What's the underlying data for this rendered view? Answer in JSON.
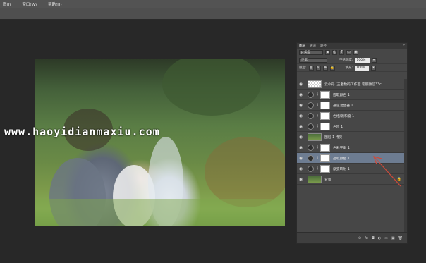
{
  "menu": [
    "图(I)",
    "窗口(W)",
    "帮助(H)"
  ],
  "watermark": "www.haoyidianmaxiu.com",
  "layers_panel": {
    "tabs": [
      "图层",
      "通道",
      "路径"
    ],
    "close": "»",
    "filter_label": "ρ 类型",
    "blend_mode": "正常",
    "opacity_label": "不透明度:",
    "opacity_value": "100%",
    "lock_label": "锁定:",
    "fill_label": "填充:",
    "fill_value": "100%",
    "layers": [
      {
        "name": "云小丹 (王者数码工作室  客服微信33c...",
        "thumb": "checker"
      },
      {
        "name": "选取颜色 1",
        "thumb": "mask"
      },
      {
        "name": "通道混合器 1",
        "thumb": "mask"
      },
      {
        "name": "色相/饱和度 1",
        "thumb": "mask"
      },
      {
        "name": "色阶 1",
        "thumb": "mask"
      },
      {
        "name": "图层 1 拷贝",
        "thumb": "photo"
      },
      {
        "name": "色彩平衡 1",
        "thumb": "mask"
      },
      {
        "name": "选取颜色 1",
        "thumb": "mask",
        "selected": true
      },
      {
        "name": "渐变映射 1",
        "thumb": "mask"
      },
      {
        "name": "背景",
        "thumb": "photo",
        "locked": true
      }
    ],
    "footer_icons": [
      "link-icon",
      "fx-icon",
      "mask-icon",
      "adjustment-icon",
      "folder-icon",
      "new-layer-icon",
      "trash-icon"
    ],
    "footer_glyphs": [
      "⊖",
      "fx",
      "◘",
      "◐",
      "▭",
      "▣",
      "🗑"
    ]
  },
  "colors": {
    "selected_layer": "#6d7c91",
    "arrow": "#d04a3a"
  }
}
